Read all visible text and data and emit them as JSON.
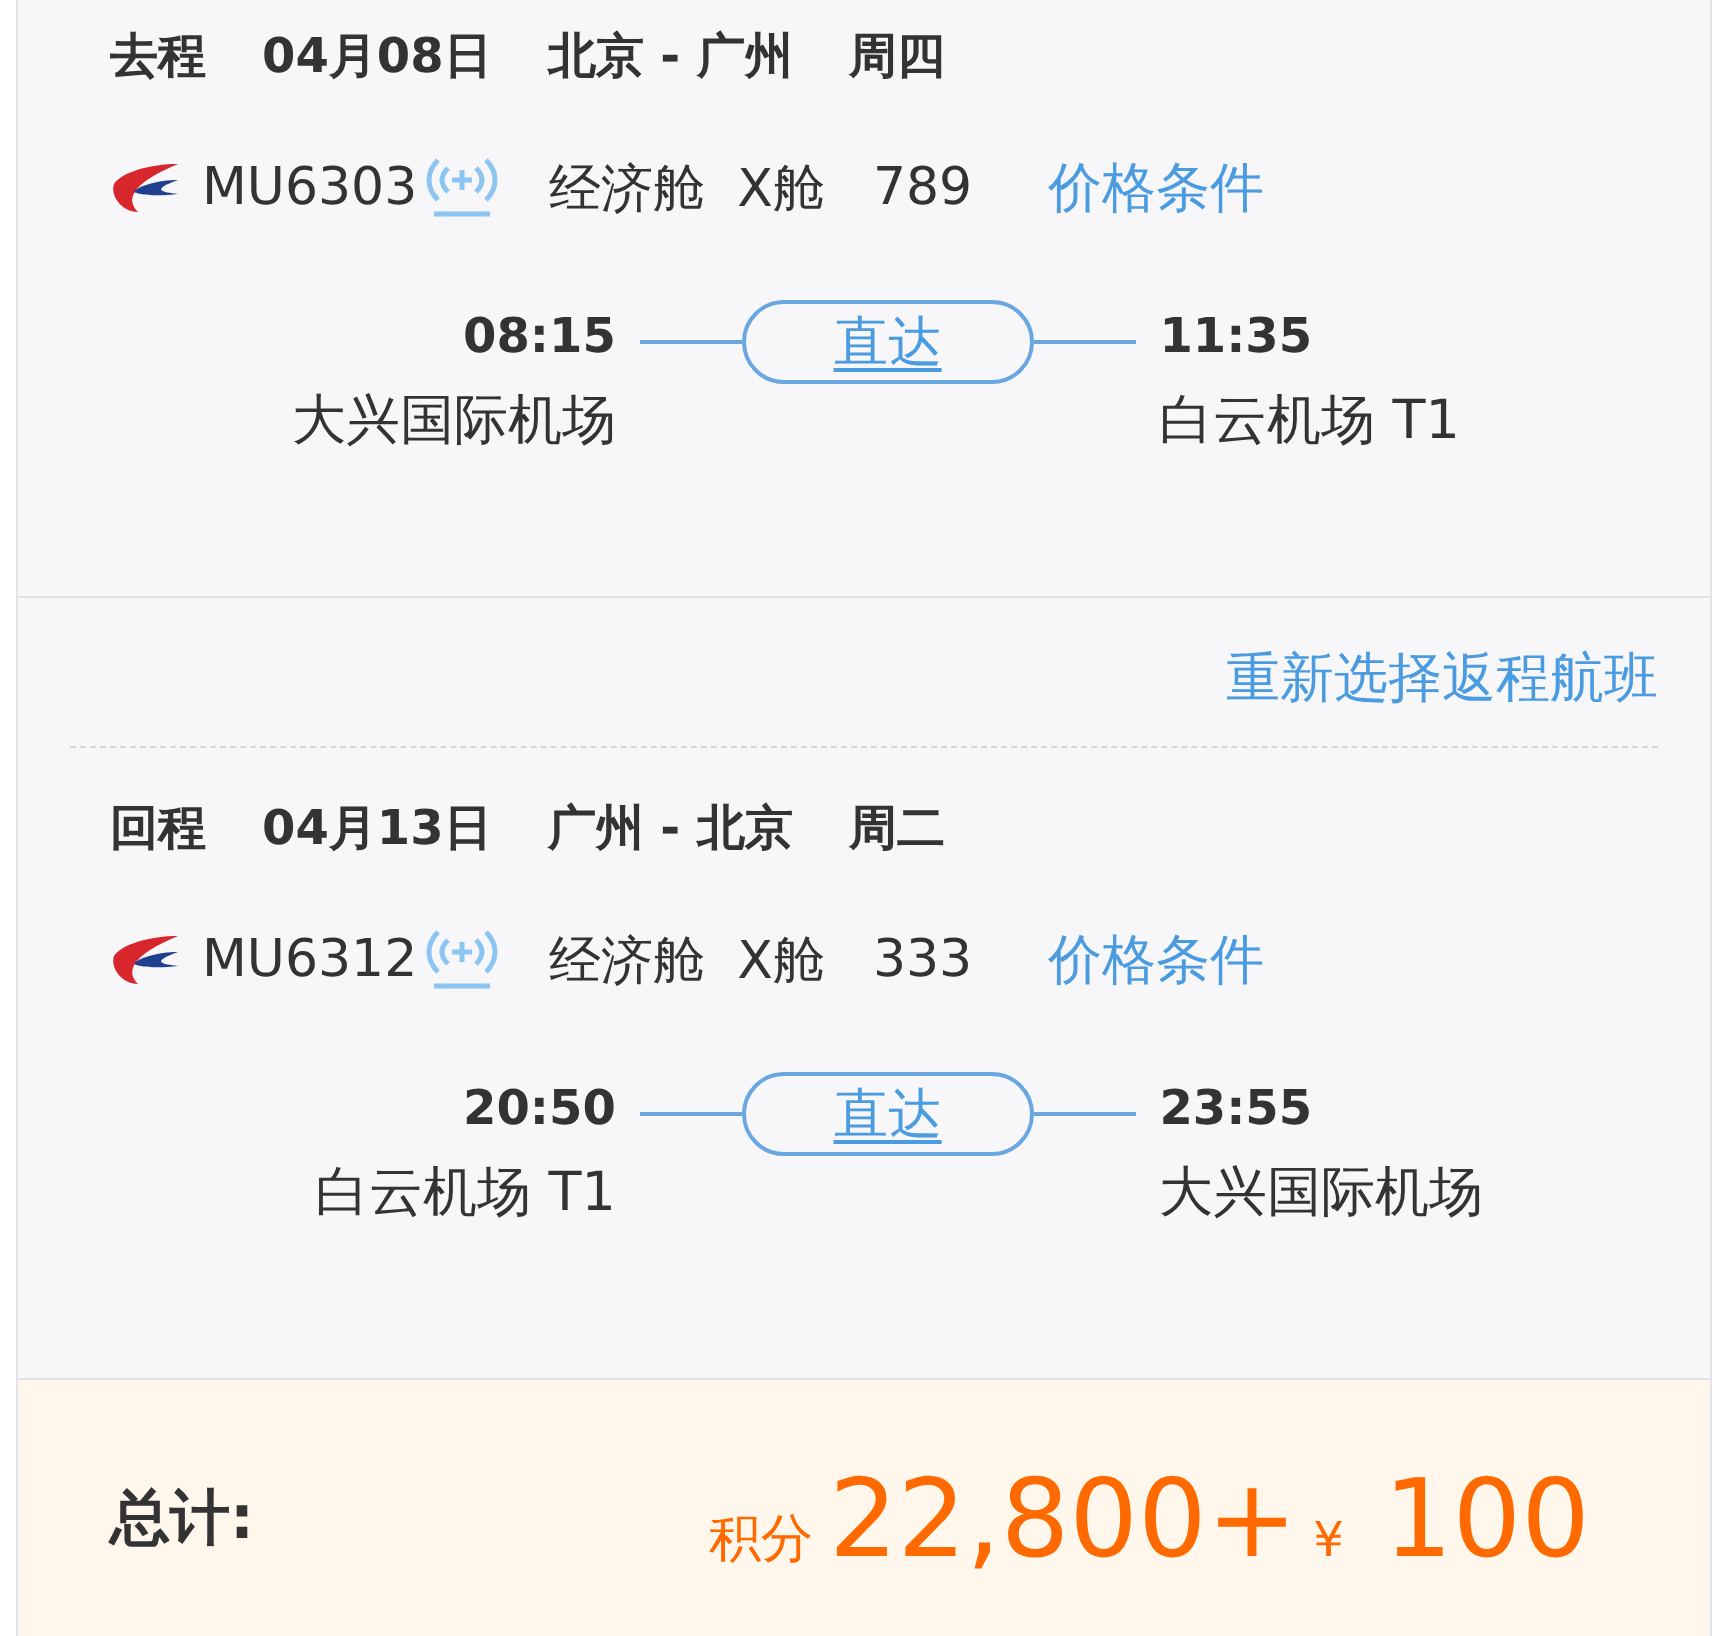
{
  "legs": [
    {
      "label": "去程",
      "date": "04月08日",
      "route": "北京 - 广州",
      "weekday": "周四",
      "flight": "MU6303",
      "cabin": "经济舱",
      "class": "X舱",
      "price": "789",
      "terms": "价格条件",
      "depart_time": "08:15",
      "depart_airport": "大兴国际机场",
      "stop": "直达",
      "arrive_time": "11:35",
      "arrive_airport": "白云机场 T1"
    },
    {
      "action": "重新选择返程航班",
      "label": "回程",
      "date": "04月13日",
      "route": "广州 - 北京",
      "weekday": "周二",
      "flight": "MU6312",
      "cabin": "经济舱",
      "class": "X舱",
      "price": "333",
      "terms": "价格条件",
      "depart_time": "20:50",
      "depart_airport": "白云机场 T1",
      "stop": "直达",
      "arrive_time": "23:55",
      "arrive_airport": "大兴国际机场"
    }
  ],
  "total": {
    "label": "总计:",
    "points_label": "积分",
    "points": "22,800+",
    "currency": "¥",
    "amount": "100"
  }
}
